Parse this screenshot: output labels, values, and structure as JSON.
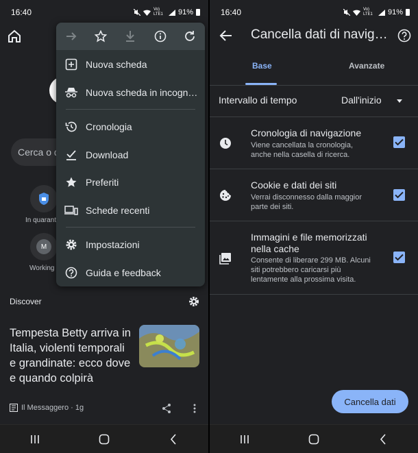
{
  "status_left": {
    "time": "16:40",
    "signal_text": "Vo) LTE1",
    "battery": "91%"
  },
  "status_right": {
    "time": "16:40",
    "signal_text": "Vo) LTE1",
    "battery": "91%"
  },
  "new_tab": {
    "search_placeholder": "Cerca o d",
    "shortcuts": [
      {
        "label": "In quarant",
        "icon": "shield-icon"
      },
      {
        "label": "Working",
        "icon": "avatar",
        "initial": "M"
      }
    ],
    "discover_label": "Discover",
    "article": {
      "title": "Tempesta Betty arriva in Italia, violenti temporali e grandinate: ecco dove e quando colpirà",
      "source": "Il Messaggero · 1g"
    }
  },
  "menu": {
    "toolbar": [
      "forward-icon",
      "star-icon",
      "download-icon",
      "info-icon",
      "reload-icon"
    ],
    "items": [
      {
        "label": "Nuova scheda",
        "icon": "new-tab-icon"
      },
      {
        "label": "Nuova scheda in incogn…",
        "icon": "incognito-icon"
      },
      {
        "label": "Cronologia",
        "icon": "history-icon"
      },
      {
        "label": "Download",
        "icon": "download-done-icon"
      },
      {
        "label": "Preferiti",
        "icon": "star-filled-icon"
      },
      {
        "label": "Schede recenti",
        "icon": "devices-icon"
      },
      {
        "label": "Impostazioni",
        "icon": "settings-icon"
      },
      {
        "label": "Guida e feedback",
        "icon": "help-icon"
      }
    ]
  },
  "clear_data": {
    "title": "Cancella dati di navig…",
    "tabs": [
      "Base",
      "Avanzate"
    ],
    "active_tab": "Base",
    "time_range_label": "Intervallo di tempo",
    "time_range_value": "Dall'inizio",
    "rows": [
      {
        "title": "Cronologia di navigazione",
        "desc": "Viene cancellata la cronologia, anche nella casella di ricerca.",
        "checked": true,
        "icon": "clock-icon"
      },
      {
        "title": "Cookie e dati dei siti",
        "desc": "Verrai disconnesso dalla maggior parte dei siti.",
        "checked": true,
        "icon": "cookie-icon"
      },
      {
        "title": "Immagini e file memorizzati nella cache",
        "desc": "Consente di liberare 299 MB. Alcuni siti potrebbero caricarsi più lentamente alla prossima visita.",
        "checked": true,
        "icon": "image-icon"
      }
    ],
    "button_label": "Cancella dati"
  },
  "colors": {
    "accent": "#8ab4f8",
    "background": "#202124",
    "menu": "#2d3436"
  }
}
